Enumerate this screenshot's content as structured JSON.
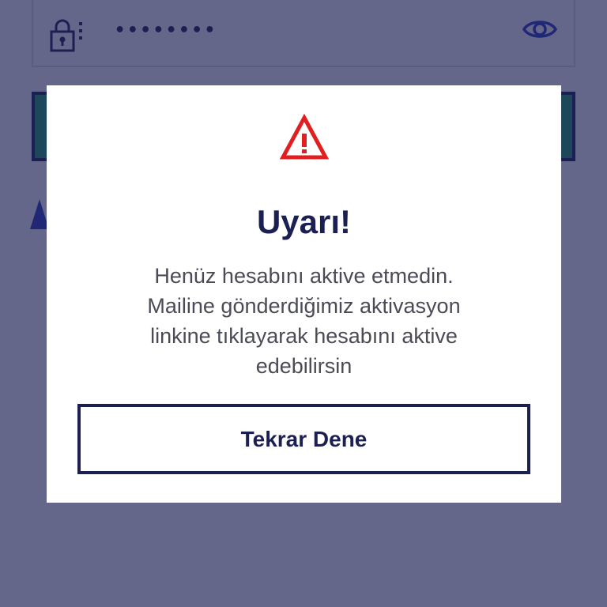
{
  "background": {
    "password_field": {
      "value": "••••••••",
      "lock_icon": "lock-icon",
      "visibility_icon": "eye-icon"
    },
    "primary_button_color": "#1f9b6c"
  },
  "dialog": {
    "icon": "warning-icon",
    "icon_color": "#e02020",
    "title": "Uyarı!",
    "message_lines": [
      "Henüz hesabını aktive etmedin.",
      "Mailine gönderdiğimiz aktivasyon",
      "linkine tıklayarak hesabını aktive",
      "edebilirsin"
    ],
    "retry_label": "Tekrar Dene"
  },
  "colors": {
    "navy": "#1c1f52",
    "overlay": "#626080",
    "text_gray": "#4a4b56"
  }
}
